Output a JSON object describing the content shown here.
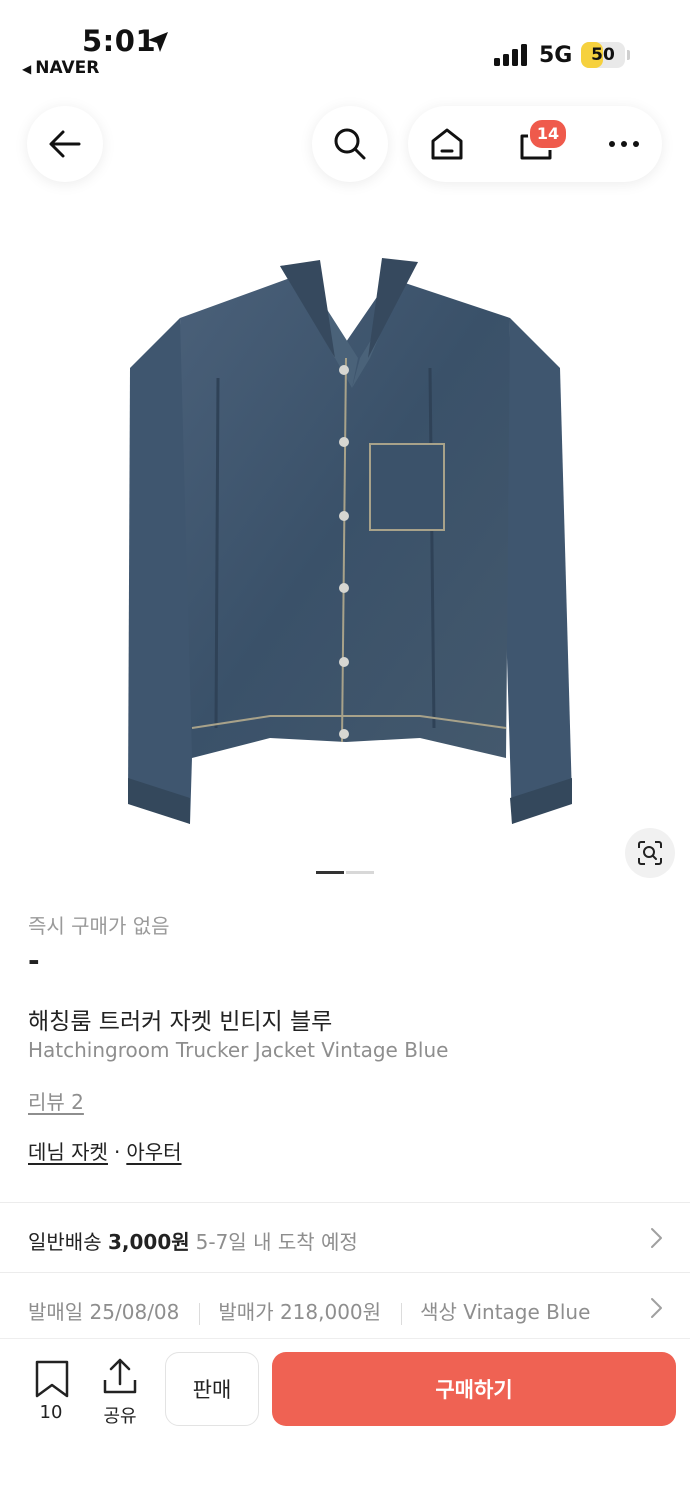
{
  "status_bar": {
    "time": "5:01",
    "back_app": "NAVER",
    "network": "5G",
    "battery": "50",
    "battery_level": 0.5
  },
  "nav": {
    "cart_count": "14"
  },
  "product": {
    "instant_buy_label": "즉시 구매가 없음",
    "price": "-",
    "name_ko": "해칭룸 트러커 자켓 빈티지 블루",
    "name_en": "Hatchingroom Trucker Jacket Vintage Blue",
    "review": "리뷰 2",
    "category_1": "데님 자켓",
    "category_sep": "·",
    "category_2": "아우터",
    "image_pages": 2,
    "current_image_page": 1
  },
  "shipping": {
    "type": "일반배송",
    "fee": "3,000원",
    "eta": "5-7일 내 도착 예정"
  },
  "meta": {
    "release_date": "발매일 25/08/08",
    "release_price": "발매가 218,000원",
    "color": "색상 Vintage Blue"
  },
  "bottom_bar": {
    "bookmark_count": "10",
    "share_label": "공유",
    "sell_label": "판매",
    "buy_label": "구매하기"
  },
  "colors": {
    "accent": "#ef6253",
    "badge": "#ef5a4c",
    "denim": "#3d556e",
    "battery": "#f6d13e"
  }
}
